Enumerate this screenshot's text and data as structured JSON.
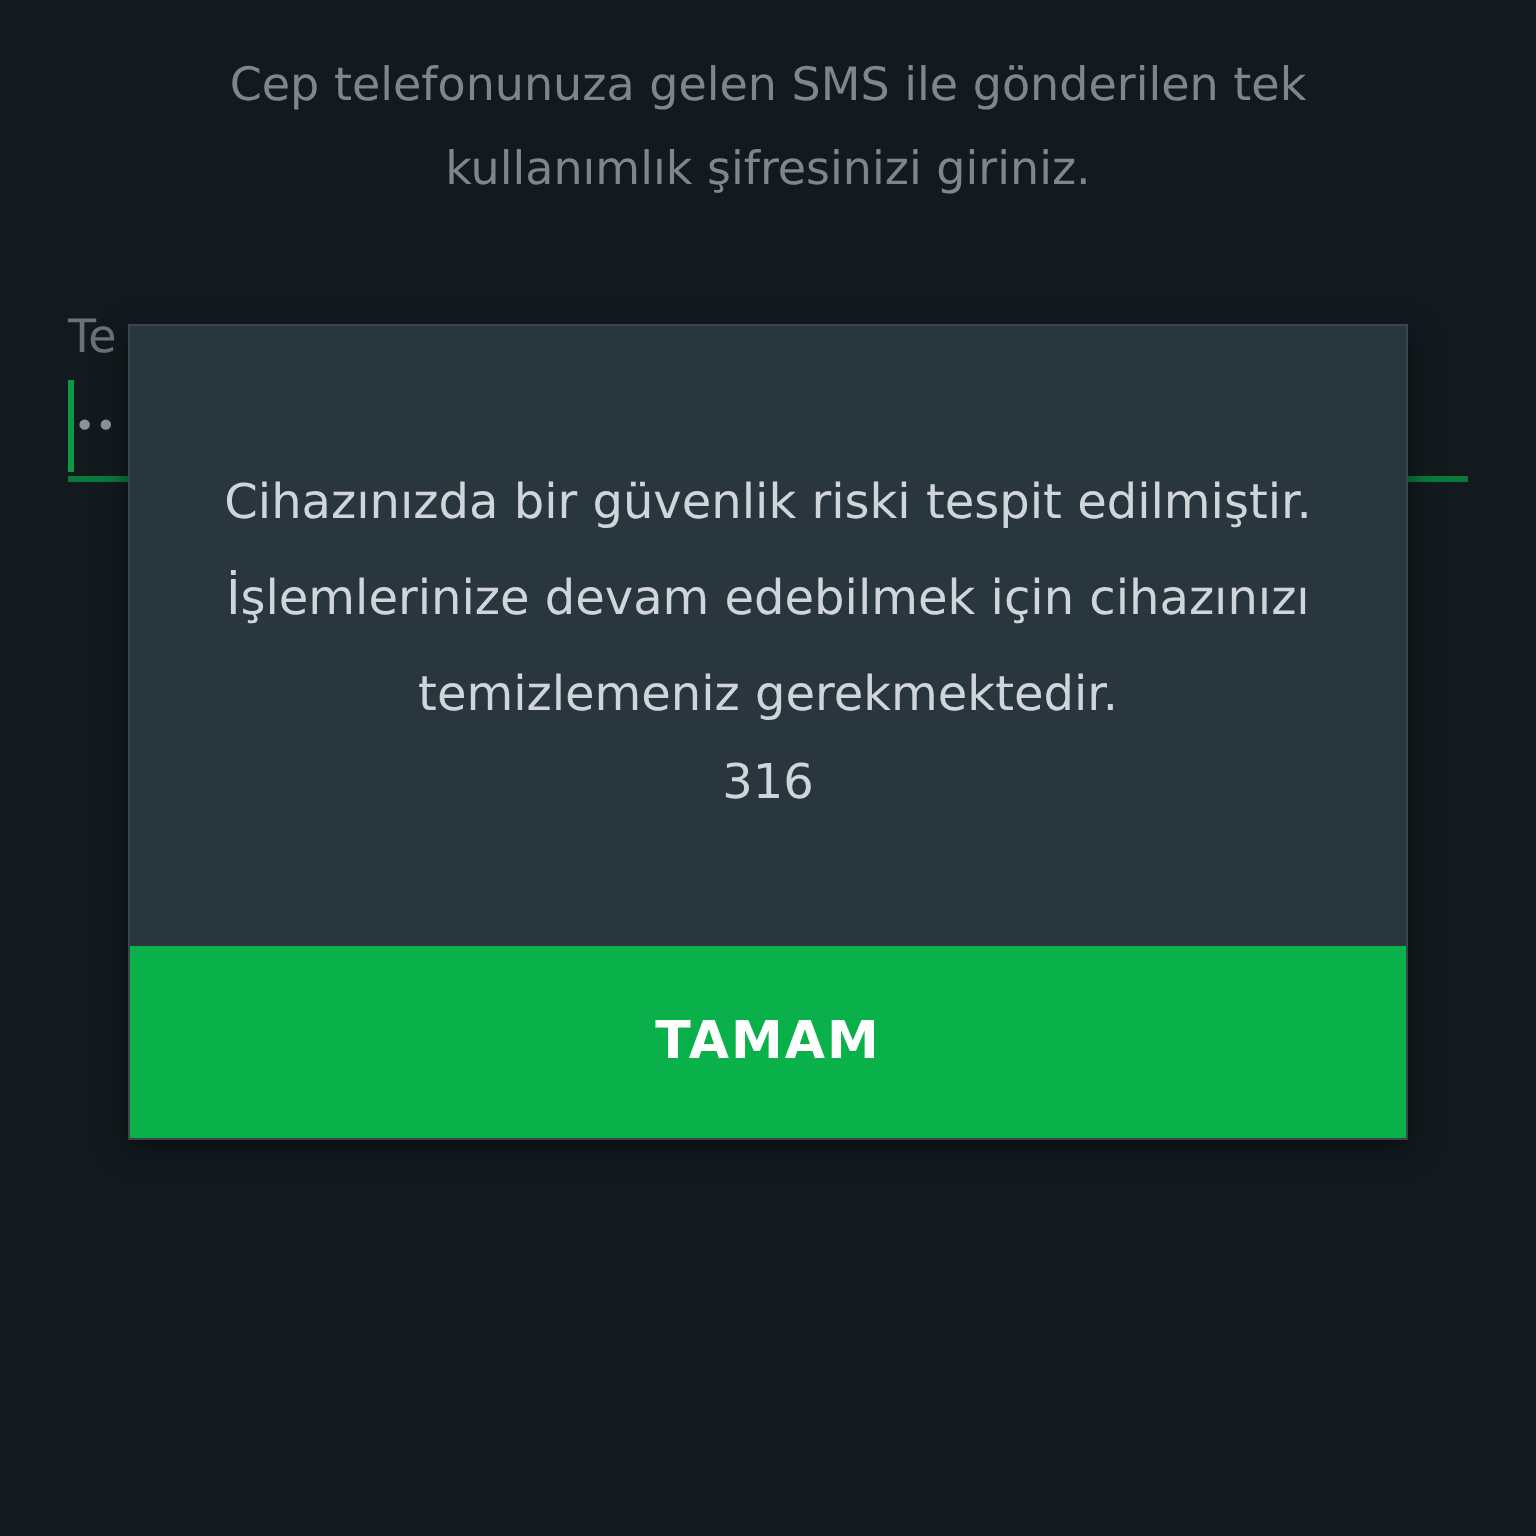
{
  "instruction": "Cep telefonunuza gelen SMS ile gönderilen tek kullanımlık şifresinizi giriniz.",
  "otp_field": {
    "label": "Te",
    "value": "••",
    "focused": true
  },
  "dialog": {
    "message": "Cihazınızda bir güvenlik riski tespit edilmiştir. İşlemlerinize devam edebilmek için cihazınızı temizlemeniz gerekmektedir.",
    "code": "316",
    "button": "TAMAM"
  }
}
